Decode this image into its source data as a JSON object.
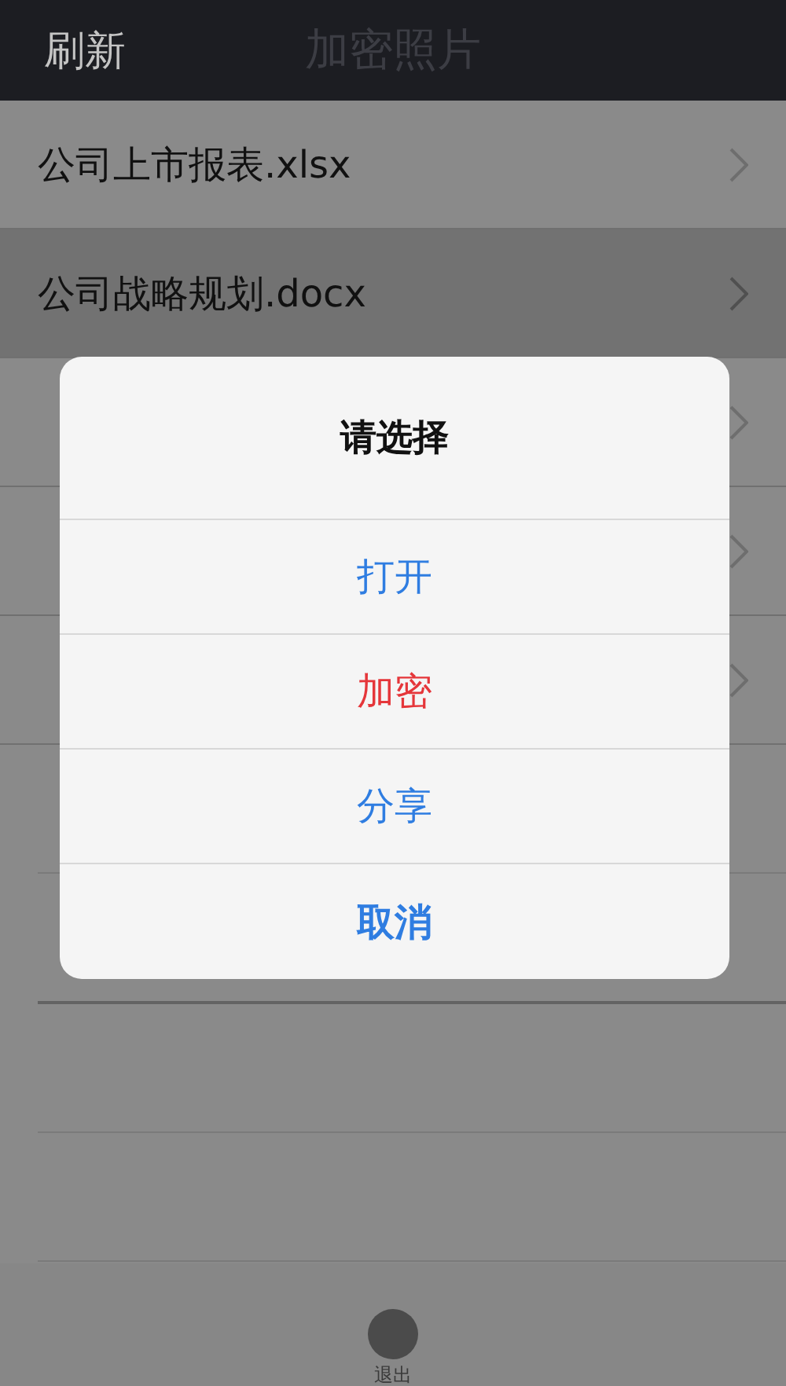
{
  "nav_bar": {
    "left_button": "刷新",
    "title": "加密照片"
  },
  "files": [
    {
      "name": "公司上市报表.xlsx",
      "selected": false
    },
    {
      "name": "公司战略规划.docx",
      "selected": true
    },
    {
      "selected": false
    },
    {
      "selected": false
    },
    {
      "selected": false
    }
  ],
  "dialog": {
    "title": "请选择",
    "actions": [
      {
        "label": "打开",
        "kind": "default"
      },
      {
        "label": "加密",
        "kind": "destructive"
      },
      {
        "label": "分享",
        "kind": "default"
      },
      {
        "label": "取消",
        "kind": "cancel"
      }
    ]
  },
  "tab_bar": {
    "items": [
      {
        "label": "退出"
      }
    ]
  }
}
